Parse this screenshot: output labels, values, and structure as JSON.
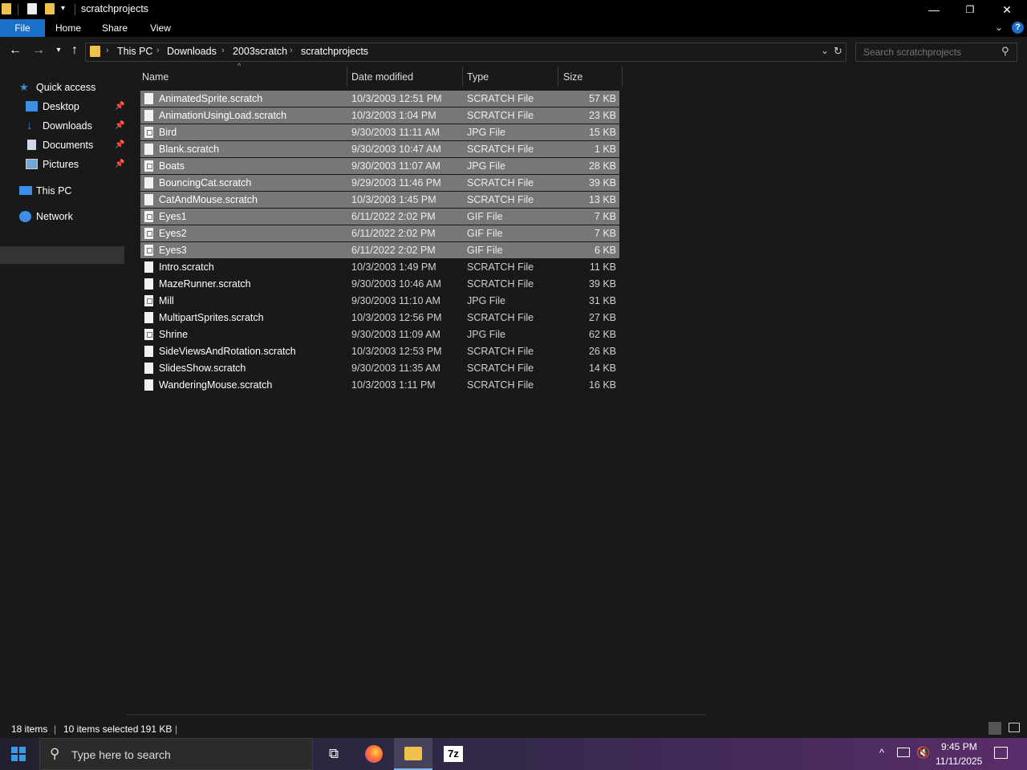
{
  "window": {
    "title": "scratchprojects",
    "minimize_glyph": "—",
    "restore_glyph": "❐",
    "close_glyph": "✕"
  },
  "ribbon": {
    "tabs": [
      "File",
      "Home",
      "Share",
      "View"
    ]
  },
  "address": {
    "crumbs": [
      "This PC",
      "Downloads",
      "2003scratch",
      "scratchprojects"
    ]
  },
  "search": {
    "placeholder": "Search scratchprojects"
  },
  "nav": {
    "quick_access": "Quick access",
    "items": [
      "Desktop",
      "Downloads",
      "Documents",
      "Pictures"
    ],
    "this_pc": "This PC",
    "network": "Network"
  },
  "columns": {
    "name": "Name",
    "date": "Date modified",
    "type": "Type",
    "size": "Size"
  },
  "files": [
    {
      "name": "AnimatedSprite.scratch",
      "date": "10/3/2003 12:51 PM",
      "type": "SCRATCH File",
      "size": "57 KB",
      "selected": true,
      "icon": "doc"
    },
    {
      "name": "AnimationUsingLoad.scratch",
      "date": "10/3/2003 1:04 PM",
      "type": "SCRATCH File",
      "size": "23 KB",
      "selected": true,
      "icon": "doc"
    },
    {
      "name": "Bird",
      "date": "9/30/2003 11:11 AM",
      "type": "JPG File",
      "size": "15 KB",
      "selected": true,
      "icon": "image"
    },
    {
      "name": "Blank.scratch",
      "date": "9/30/2003 10:47 AM",
      "type": "SCRATCH File",
      "size": "1 KB",
      "selected": true,
      "icon": "doc"
    },
    {
      "name": "Boats",
      "date": "9/30/2003 11:07 AM",
      "type": "JPG File",
      "size": "28 KB",
      "selected": true,
      "icon": "image"
    },
    {
      "name": "BouncingCat.scratch",
      "date": "9/29/2003 11:46 PM",
      "type": "SCRATCH File",
      "size": "39 KB",
      "selected": true,
      "icon": "doc"
    },
    {
      "name": "CatAndMouse.scratch",
      "date": "10/3/2003 1:45 PM",
      "type": "SCRATCH File",
      "size": "13 KB",
      "selected": true,
      "icon": "doc"
    },
    {
      "name": "Eyes1",
      "date": "6/11/2022 2:02 PM",
      "type": "GIF File",
      "size": "7 KB",
      "selected": true,
      "icon": "image"
    },
    {
      "name": "Eyes2",
      "date": "6/11/2022 2:02 PM",
      "type": "GIF File",
      "size": "7 KB",
      "selected": true,
      "icon": "image"
    },
    {
      "name": "Eyes3",
      "date": "6/11/2022 2:02 PM",
      "type": "GIF File",
      "size": "6 KB",
      "selected": true,
      "icon": "image"
    },
    {
      "name": "Intro.scratch",
      "date": "10/3/2003 1:49 PM",
      "type": "SCRATCH File",
      "size": "11 KB",
      "selected": false,
      "icon": "doc"
    },
    {
      "name": "MazeRunner.scratch",
      "date": "9/30/2003 10:46 AM",
      "type": "SCRATCH File",
      "size": "39 KB",
      "selected": false,
      "icon": "doc"
    },
    {
      "name": "Mill",
      "date": "9/30/2003 11:10 AM",
      "type": "JPG File",
      "size": "31 KB",
      "selected": false,
      "icon": "image"
    },
    {
      "name": "MultipartSprites.scratch",
      "date": "10/3/2003 12:56 PM",
      "type": "SCRATCH File",
      "size": "27 KB",
      "selected": false,
      "icon": "doc"
    },
    {
      "name": "Shrine",
      "date": "9/30/2003 11:09 AM",
      "type": "JPG File",
      "size": "62 KB",
      "selected": false,
      "icon": "image"
    },
    {
      "name": "SideViewsAndRotation.scratch",
      "date": "10/3/2003 12:53 PM",
      "type": "SCRATCH File",
      "size": "26 KB",
      "selected": false,
      "icon": "doc"
    },
    {
      "name": "SlidesShow.scratch",
      "date": "9/30/2003 11:35 AM",
      "type": "SCRATCH File",
      "size": "14 KB",
      "selected": false,
      "icon": "doc"
    },
    {
      "name": "WanderingMouse.scratch",
      "date": "10/3/2003 1:11 PM",
      "type": "SCRATCH File",
      "size": "16 KB",
      "selected": false,
      "icon": "doc"
    }
  ],
  "status": {
    "count": "18 items",
    "selected": "10 items selected",
    "size": "191 KB"
  },
  "taskbar": {
    "search_placeholder": "Type here to search",
    "time": "9:45 PM",
    "date": "11/11/2025",
    "zip_label": "7z"
  },
  "colors": {
    "accent": "#1a6fc9",
    "selection": "#777777",
    "background": "#191919"
  }
}
